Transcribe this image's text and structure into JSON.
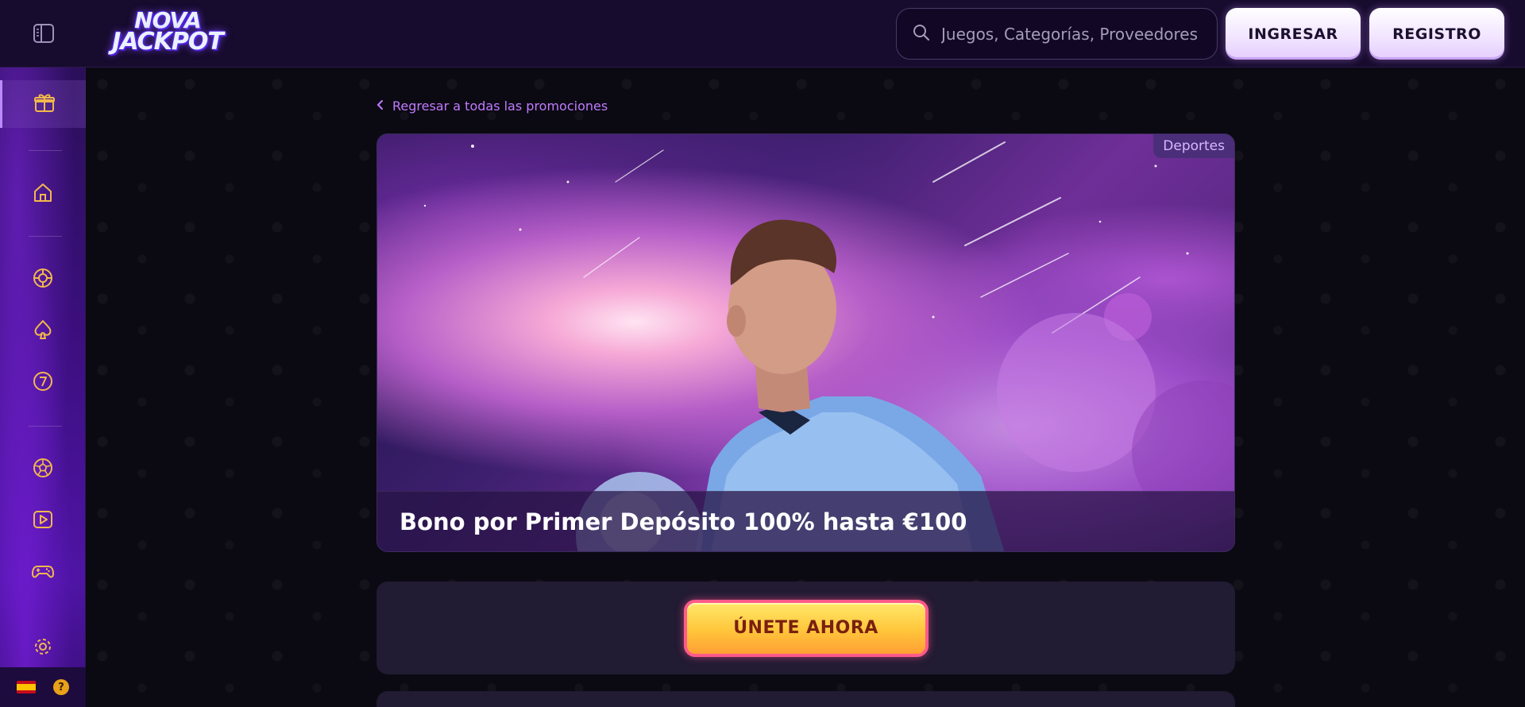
{
  "header": {
    "logo": {
      "line1": "NOVA",
      "line2": "JACKPOT"
    },
    "search": {
      "placeholder": "Juegos, Categorías, Proveedores"
    },
    "login_label": "INGRESAR",
    "register_label": "REGISTRO"
  },
  "sidebar": {
    "items": [
      {
        "icon": "gift-icon",
        "active": true
      },
      {
        "icon": "home-icon"
      },
      {
        "icon": "roulette-icon"
      },
      {
        "icon": "spade-icon"
      },
      {
        "icon": "seven-icon"
      },
      {
        "icon": "soccer-ball-icon"
      },
      {
        "icon": "video-play-icon"
      },
      {
        "icon": "gamepad-icon"
      },
      {
        "icon": "settings-icon"
      }
    ],
    "footer": {
      "language_icon": "spain-flag-icon",
      "help_label": "?"
    }
  },
  "main": {
    "back_link": "Regresar a todas las promociones",
    "promo": {
      "tag": "Deportes",
      "title": "Bono por Primer Depósito 100% hasta €100"
    },
    "cta_label": "ÚNETE AHORA"
  },
  "colors": {
    "header_bg": "#170b2e",
    "accent_purple": "#c17bff",
    "cta_yellow": "#ffc53a",
    "cta_border": "#ff5b8a"
  }
}
